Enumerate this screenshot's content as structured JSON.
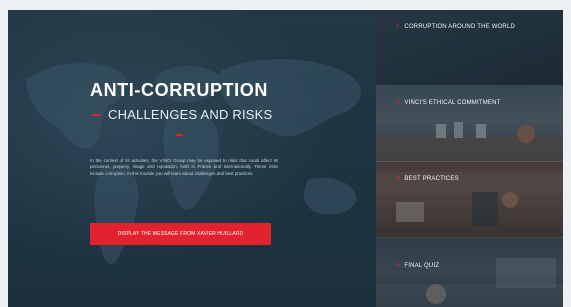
{
  "hero": {
    "title": "ANTI-CORRUPTION",
    "subtitle": "CHALLENGES AND RISKS",
    "intro": "In the context of its activities, the VINCI Group may be exposed to risks that could affect its personnel, property, image and reputation, both in France and internationally. These risks include corruption. In this module you will learn about challenges and best practices.",
    "cta_label": "DISPLAY THE MESSAGE FROM XAVIER HUILLARD"
  },
  "menu": {
    "items": [
      {
        "number": "1.",
        "label": "CORRUPTION AROUND THE WORLD"
      },
      {
        "number": "2.",
        "label": "VINCI'S ETHICAL COMMITMENT"
      },
      {
        "number": "3.",
        "label": "BEST PRACTICES"
      },
      {
        "number": "4.",
        "label": "FINAL QUIZ"
      }
    ]
  },
  "colors": {
    "accent": "#e2232f",
    "background": "#1f3442"
  }
}
